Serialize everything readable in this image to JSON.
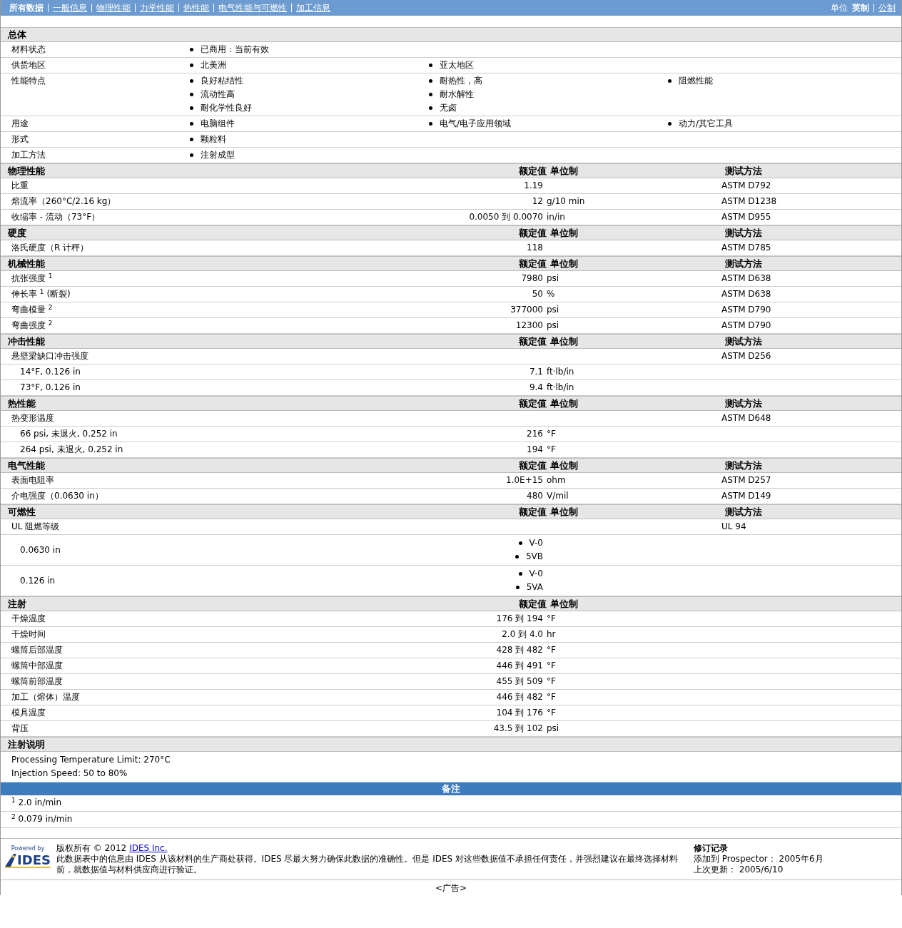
{
  "nav": {
    "items": [
      {
        "label": "所有数据",
        "selected": true
      },
      {
        "label": "一般信息",
        "selected": false
      },
      {
        "label": "物理性能",
        "selected": false
      },
      {
        "label": "力学性能",
        "selected": false
      },
      {
        "label": "热性能",
        "selected": false
      },
      {
        "label": "电气性能与可燃性",
        "selected": false
      },
      {
        "label": "加工信息",
        "selected": false
      }
    ],
    "units": {
      "label": "单位",
      "options": [
        {
          "label": "英制",
          "selected": true
        },
        {
          "label": "公制",
          "selected": false
        }
      ]
    }
  },
  "general": {
    "title": "总体",
    "rows": [
      {
        "label": "材料状态",
        "columns": [
          [
            "已商用：当前有效"
          ]
        ]
      },
      {
        "label": "供货地区",
        "columns": [
          [
            "北美洲"
          ],
          [
            "亚太地区"
          ]
        ]
      },
      {
        "label": "性能特点",
        "columns": [
          [
            "良好粘结性",
            "流动性高",
            "耐化学性良好"
          ],
          [
            "耐热性，高",
            "耐水解性",
            "无卤"
          ],
          [
            "阻燃性能"
          ]
        ]
      },
      {
        "label": "用途",
        "columns": [
          [
            "电脑组件"
          ],
          [
            "电气/电子应用领域"
          ],
          [
            "动力/其它工具"
          ]
        ]
      },
      {
        "label": "形式",
        "columns": [
          [
            "颗粒料"
          ]
        ]
      },
      {
        "label": "加工方法",
        "columns": [
          [
            "注射成型"
          ]
        ]
      }
    ]
  },
  "sections": [
    {
      "title": "物理性能",
      "headers": {
        "value": "额定值",
        "unit": "单位制",
        "method": "测试方法"
      },
      "rows": [
        {
          "kind": "data",
          "label": "比重",
          "value": "1.19",
          "method": "ASTM D792"
        },
        {
          "kind": "data",
          "label": "熔流率（260°C/2.16 kg）",
          "value": "12",
          "unit": "g/10 min",
          "method": "ASTM D1238"
        },
        {
          "kind": "data",
          "label": "收缩率 - 流动（73°F）",
          "value": "0.0050 到  0.0070",
          "unit": "in/in",
          "method": "ASTM D955"
        }
      ]
    },
    {
      "title": "硬度",
      "headers": {
        "value": "额定值",
        "unit": "单位制",
        "method": "测试方法"
      },
      "rows": [
        {
          "kind": "data",
          "label": "洛氏硬度（R 计秤）",
          "value": "118",
          "method": "ASTM D785"
        }
      ]
    },
    {
      "title": "机械性能",
      "headers": {
        "value": "额定值",
        "unit": "单位制",
        "method": "测试方法"
      },
      "rows": [
        {
          "kind": "data",
          "label": "抗张强度 $^{1}$",
          "value": "7980",
          "unit": "psi",
          "method": "ASTM D638"
        },
        {
          "kind": "data",
          "label": "伸长率 $^{1}$ (断裂)",
          "value": "50",
          "unit": "%",
          "method": "ASTM D638"
        },
        {
          "kind": "data",
          "label": "弯曲模量 $^{2}$",
          "value": "377000",
          "unit": "psi",
          "method": "ASTM D790"
        },
        {
          "kind": "data",
          "label": "弯曲强度 $^{2}$",
          "value": "12300",
          "unit": "psi",
          "method": "ASTM D790"
        }
      ]
    },
    {
      "title": "冲击性能",
      "headers": {
        "value": "额定值",
        "unit": "单位制",
        "method": "测试方法"
      },
      "rows": [
        {
          "kind": "data",
          "label": "悬壁梁缺口冲击强度",
          "method": "ASTM D256"
        },
        {
          "kind": "sub",
          "label": "14°F, 0.126 in",
          "value": "7.1",
          "unit": "ft·lb/in"
        },
        {
          "kind": "sub",
          "label": "73°F, 0.126 in",
          "value": "9.4",
          "unit": "ft·lb/in"
        }
      ]
    },
    {
      "title": "热性能",
      "headers": {
        "value": "额定值",
        "unit": "单位制",
        "method": "测试方法"
      },
      "rows": [
        {
          "kind": "data",
          "label": "热变形温度",
          "method": "ASTM D648"
        },
        {
          "kind": "sub",
          "label": "66 psi, 未退火, 0.252 in",
          "value": "216",
          "unit": "°F"
        },
        {
          "kind": "sub",
          "label": "264 psi, 未退火, 0.252 in",
          "value": "194",
          "unit": "°F"
        }
      ]
    },
    {
      "title": "电气性能",
      "headers": {
        "value": "额定值",
        "unit": "单位制",
        "method": "测试方法"
      },
      "rows": [
        {
          "kind": "data",
          "label": "表面电阻率",
          "value": "1.0E+15",
          "unit": "ohm",
          "method": "ASTM D257"
        },
        {
          "kind": "data",
          "label": "介电强度（0.0630 in）",
          "value": "480",
          "unit": "V/mil",
          "method": "ASTM D149"
        }
      ]
    },
    {
      "title": "可燃性",
      "headers": {
        "value": "额定值",
        "unit": "单位制",
        "method": "测试方法"
      },
      "rows": [
        {
          "kind": "data",
          "label": "UL 阻燃等级",
          "method": "UL 94"
        },
        {
          "kind": "bullets",
          "label": "0.0630 in",
          "values": [
            "V-0",
            "5VB"
          ]
        },
        {
          "kind": "bullets",
          "label": "0.126 in",
          "values": [
            "V-0",
            "5VA"
          ]
        }
      ]
    },
    {
      "title": "注射",
      "headers": {
        "value": "额定值",
        "unit": "单位制"
      },
      "rows": [
        {
          "kind": "data",
          "label": "干燥温度",
          "value": "176 到  194",
          "unit": "°F"
        },
        {
          "kind": "data",
          "label": "干燥时间",
          "value": "2.0 到  4.0",
          "unit": "hr"
        },
        {
          "kind": "data",
          "label": "螺筒后部温度",
          "value": "428 到  482",
          "unit": "°F"
        },
        {
          "kind": "data",
          "label": "螺筒中部温度",
          "value": "446 到  491",
          "unit": "°F"
        },
        {
          "kind": "data",
          "label": "螺筒前部温度",
          "value": "455 到  509",
          "unit": "°F"
        },
        {
          "kind": "data",
          "label": "加工（熔体）温度",
          "value": "446 到  482",
          "unit": "°F"
        },
        {
          "kind": "data",
          "label": "模具温度",
          "value": "104 到  176",
          "unit": "°F"
        },
        {
          "kind": "data",
          "label": "背压",
          "value": "43.5 到  102",
          "unit": "psi"
        }
      ]
    }
  ],
  "injection_notes": {
    "title": "注射说明",
    "lines": [
      "Processing Temperature Limit: 270°C",
      "Injection Speed: 50 to 80%"
    ]
  },
  "footnotes": {
    "title": "备注",
    "items": [
      "$^{1}$ 2.0 in/min",
      "$^{2}$ 0.079 in/min"
    ]
  },
  "footer": {
    "powered_by": "Powered by",
    "logo": "IDES",
    "copyright": "版权所有  © 2012",
    "link": "IDES Inc.",
    "disclaimer": "此数据表中的信息由  IDES 从该材料的生产商处获得。IDES 尽最大努力确保此数据的准确性。但是  IDES 对这些数据值不承担任何责任，并强烈建议在最终选择材料前，就数据值与材料供应商进行验证。",
    "revision": {
      "title": "修订记录",
      "lines": [
        "添加到 Prospector：  2005年6月",
        "上次更新：  2005/6/10"
      ]
    }
  },
  "ad": "<广告>"
}
